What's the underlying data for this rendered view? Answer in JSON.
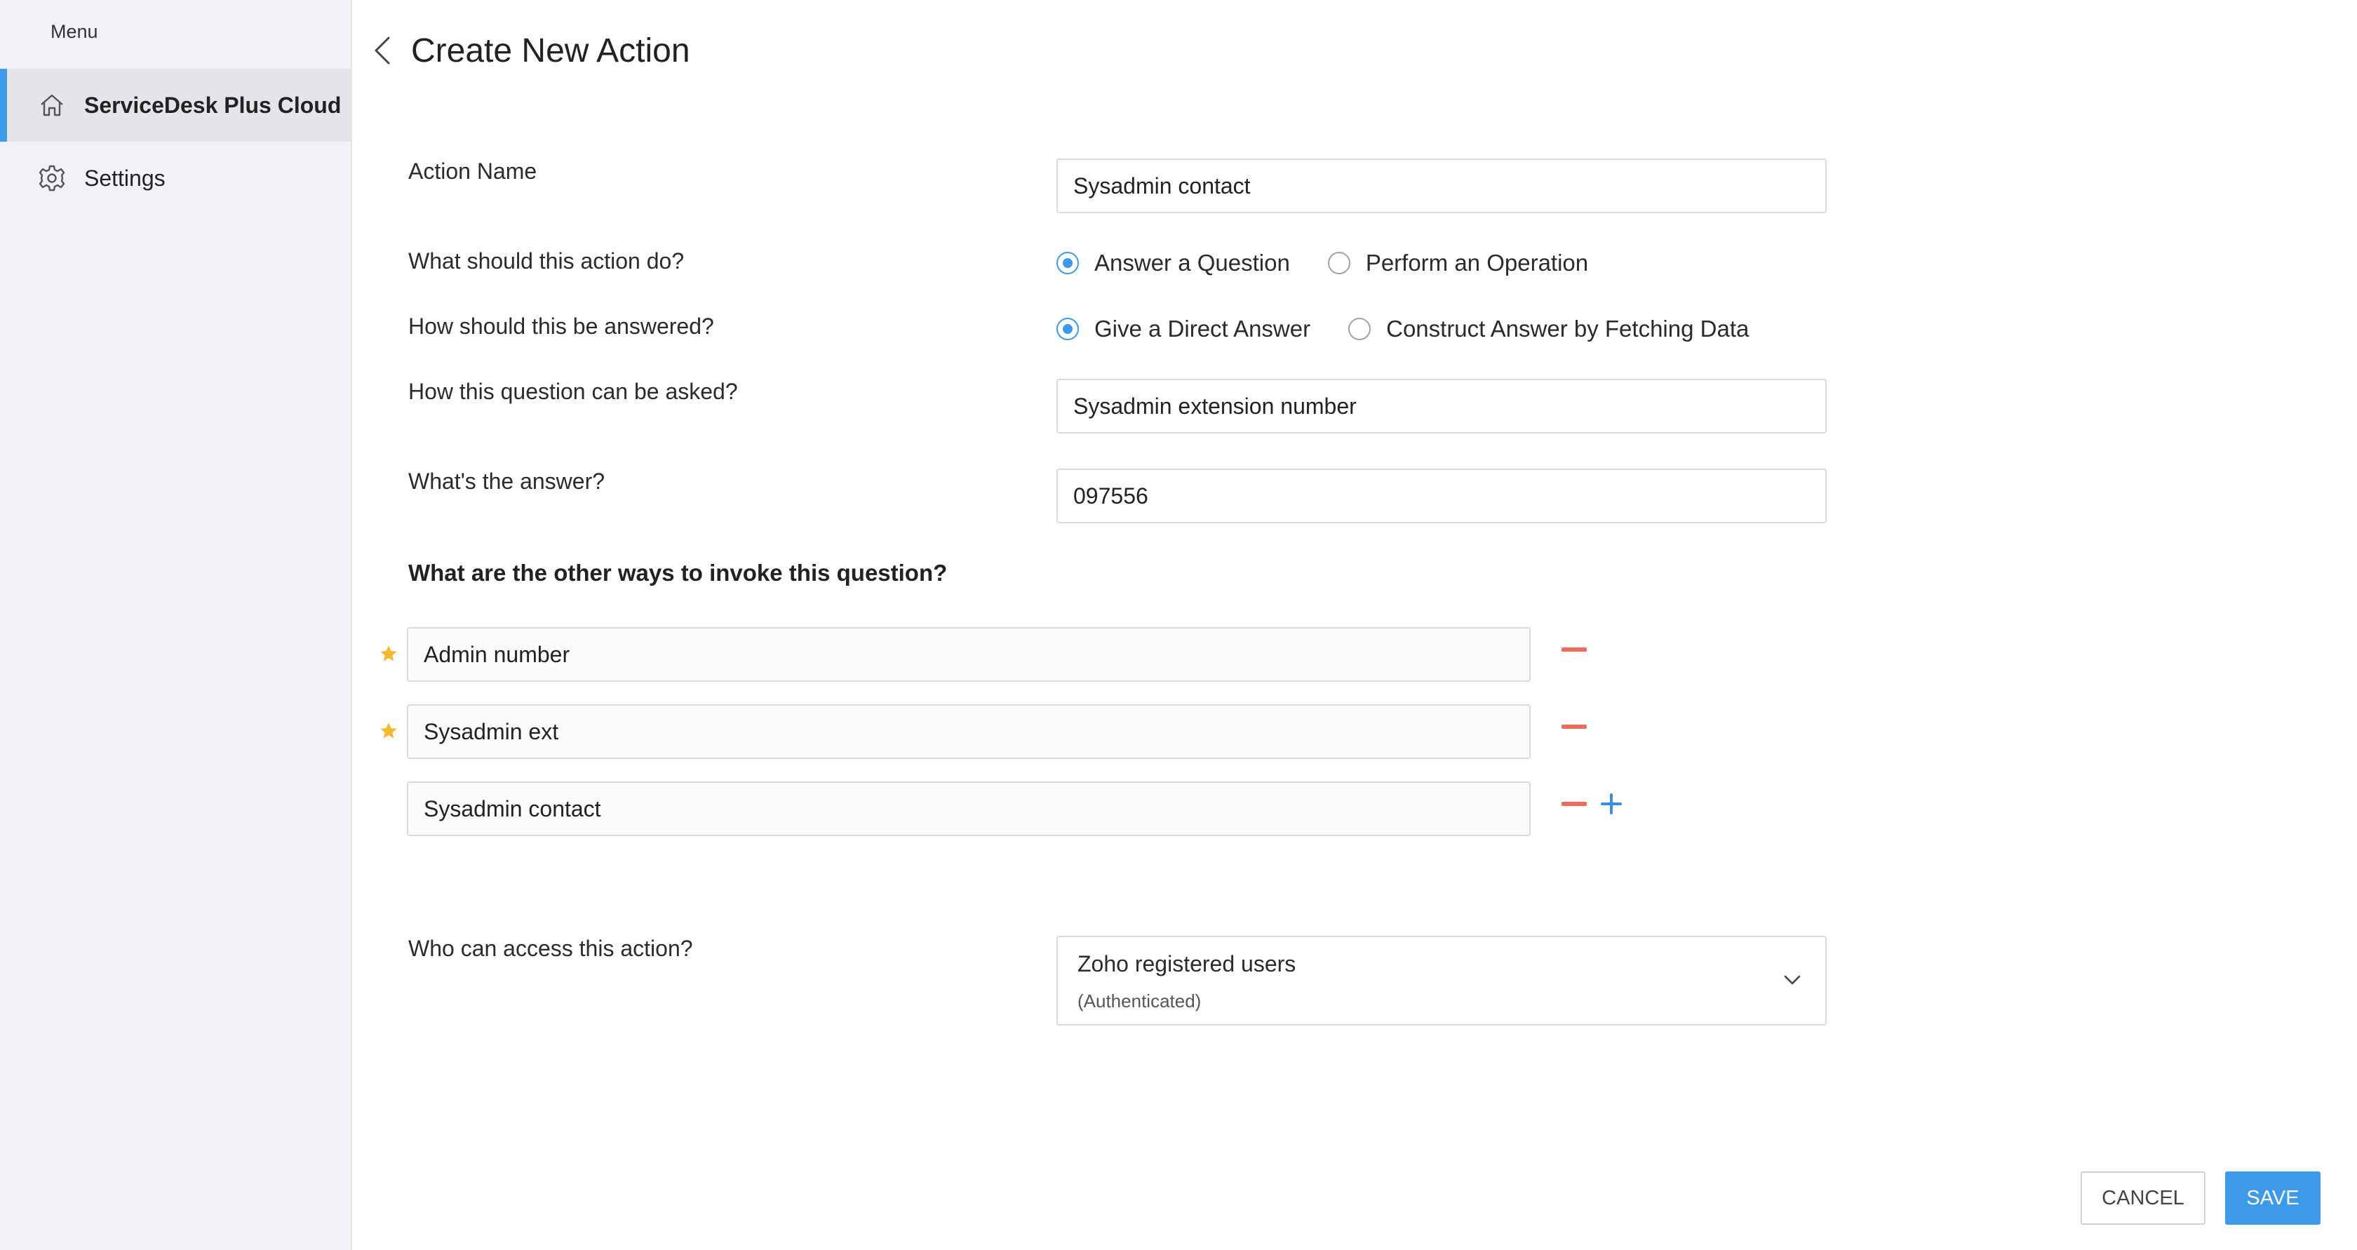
{
  "sidebar": {
    "menu_label": "Menu",
    "items": [
      {
        "label": "ServiceDesk Plus Cloud",
        "icon": "home-icon",
        "active": true
      },
      {
        "label": "Settings",
        "icon": "gear-icon",
        "active": false
      }
    ]
  },
  "page": {
    "title": "Create New Action"
  },
  "form": {
    "action_name": {
      "label": "Action Name",
      "value": "Sysadmin contact"
    },
    "action_type": {
      "label": "What should this action do?",
      "options": [
        "Answer a Question",
        "Perform an Operation"
      ],
      "selected": "Answer a Question"
    },
    "answer_type": {
      "label": "How should this be answered?",
      "options": [
        "Give a Direct Answer",
        "Construct Answer by Fetching Data"
      ],
      "selected": "Give a Direct Answer"
    },
    "question": {
      "label": "How this question can be asked?",
      "value": "Sysadmin extension number"
    },
    "answer": {
      "label": "What's the answer?",
      "value": "097556"
    },
    "other_ways": {
      "title": "What are the other ways to invoke this question?",
      "items": [
        {
          "value": "Admin number",
          "starred": true
        },
        {
          "value": "Sysadmin ext",
          "starred": true
        },
        {
          "value": "Sysadmin contact",
          "starred": false
        }
      ]
    },
    "access": {
      "label": "Who can access this action?",
      "selected_main": "Zoho registered users",
      "selected_sub": "(Authenticated)"
    }
  },
  "buttons": {
    "cancel": "CANCEL",
    "save": "SAVE"
  },
  "colors": {
    "accent": "#3d9ae8",
    "remove": "#ef6a5b",
    "star": "#f5b82e",
    "sidebar_bg": "#f1f2f5"
  }
}
